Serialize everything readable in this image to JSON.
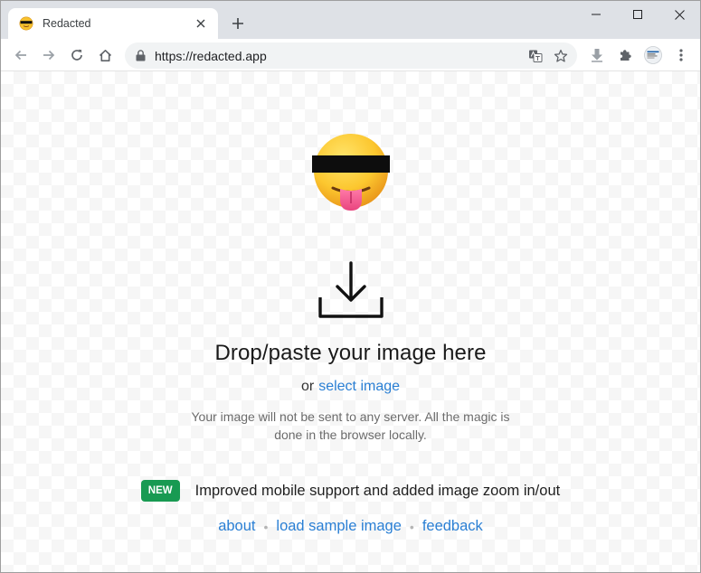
{
  "browser": {
    "tab_title": "Redacted",
    "url": "https://redacted.app"
  },
  "page": {
    "headline": "Drop/paste your image here",
    "or_prefix": "or",
    "select_link": "select image",
    "privacy_note": "Your image will not be sent to any server. All the magic is done in the browser locally.",
    "news_badge": "NEW",
    "news_text": "Improved mobile support and added image zoom in/out",
    "footer_links": [
      "about",
      "load sample image",
      "feedback"
    ],
    "separator": "•"
  },
  "icons": {
    "hero": "redacted-tongue-emoji-icon",
    "drop": "download-tray-icon"
  },
  "colors": {
    "link": "#2a7fd4",
    "badge": "#189a52",
    "tabstrip": "#dee1e6"
  }
}
